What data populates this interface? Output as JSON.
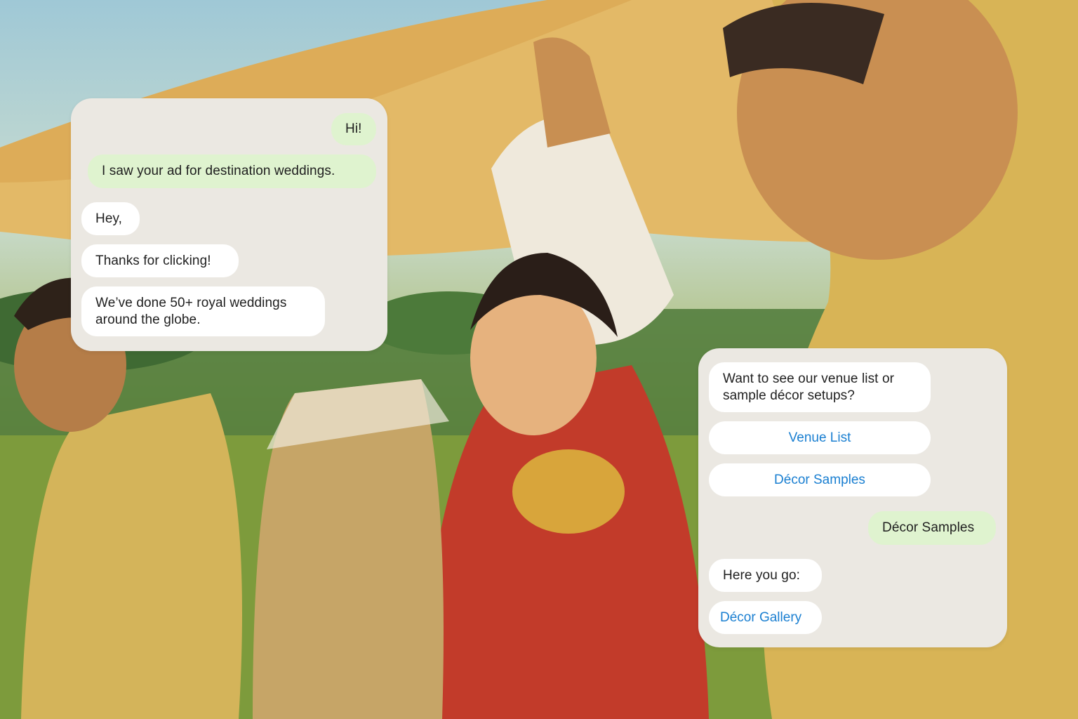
{
  "left_chat": {
    "messages": [
      {
        "from": "user",
        "text": "Hi!"
      },
      {
        "from": "user",
        "text": "I saw your ad for destination weddings."
      },
      {
        "from": "bot",
        "text": "Hey,"
      },
      {
        "from": "bot",
        "text": "Thanks for clicking!"
      },
      {
        "from": "bot",
        "text": "We’ve done 50+ royal weddings around the globe."
      }
    ]
  },
  "right_chat": {
    "question": "Want to see our venue list or sample décor setups?",
    "options": [
      "Venue List",
      "Décor Samples"
    ],
    "user_reply": "Décor Samples",
    "bot_reply": "Here you go:",
    "link": "Décor Gallery"
  },
  "colors": {
    "panel_bg": "#ebe8e2",
    "user_bubble": "#dff3cf",
    "bot_bubble": "#ffffff",
    "link_blue": "#1a7fd1"
  }
}
